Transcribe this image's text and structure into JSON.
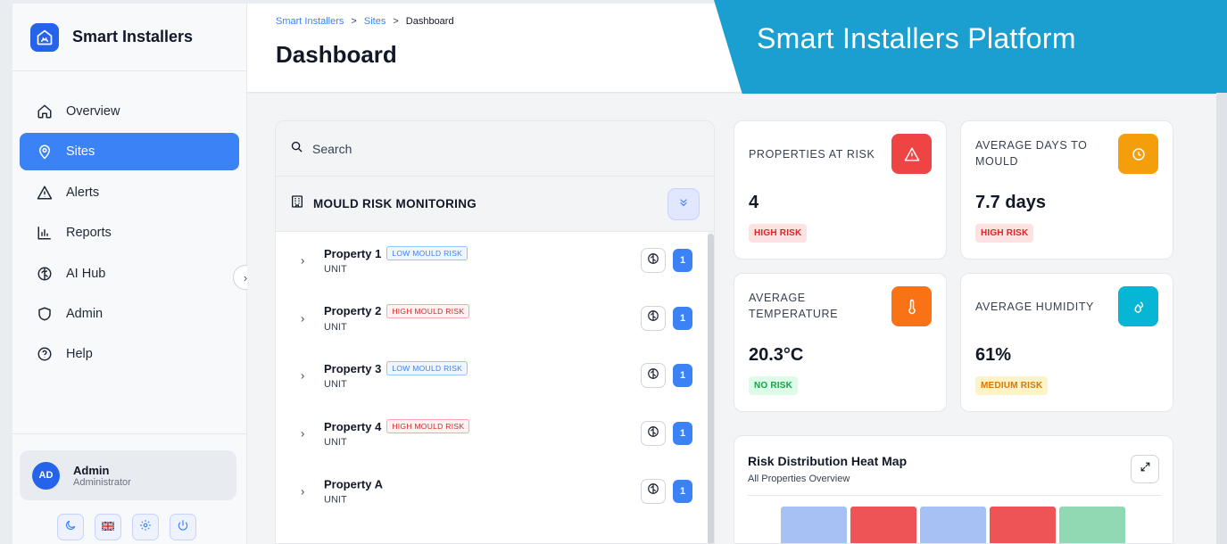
{
  "brand": {
    "name": "Smart Installers"
  },
  "sidebar": {
    "items": [
      {
        "label": "Overview",
        "icon": "home-icon"
      },
      {
        "label": "Sites",
        "icon": "location-pin-icon",
        "active": true
      },
      {
        "label": "Alerts",
        "icon": "warning-icon"
      },
      {
        "label": "Reports",
        "icon": "bar-chart-icon"
      },
      {
        "label": "AI Hub",
        "icon": "brain-icon"
      },
      {
        "label": "Admin",
        "icon": "shield-icon"
      },
      {
        "label": "Help",
        "icon": "help-circle-icon"
      }
    ]
  },
  "user": {
    "initials": "AD",
    "name": "Admin",
    "role": "Administrator"
  },
  "header": {
    "breadcrumb": [
      "Smart Installers",
      "Sites",
      "Dashboard"
    ],
    "title": "Dashboard"
  },
  "banner": {
    "text": "Smart Installers Platform"
  },
  "panel": {
    "search_placeholder": "Search",
    "section_title": "MOULD RISK MONITORING",
    "properties": [
      {
        "name": "Property 1",
        "badge": "LOW MOULD RISK",
        "level": "low",
        "sub": "UNIT",
        "count": "1"
      },
      {
        "name": "Property 2",
        "badge": "HIGH MOULD RISK",
        "level": "high",
        "sub": "UNIT",
        "count": "1"
      },
      {
        "name": "Property 3",
        "badge": "LOW MOULD RISK",
        "level": "low",
        "sub": "UNIT",
        "count": "1"
      },
      {
        "name": "Property 4",
        "badge": "HIGH MOULD RISK",
        "level": "high",
        "sub": "UNIT",
        "count": "1"
      },
      {
        "name": "Property A",
        "badge": "",
        "level": "",
        "sub": "UNIT",
        "count": "1"
      }
    ]
  },
  "stats": {
    "properties_at_risk": {
      "label": "PROPERTIES AT RISK",
      "value": "4",
      "badge": "HIGH RISK",
      "icon": "warning-icon",
      "color": "#ef4444"
    },
    "avg_days_to_mould": {
      "label": "AVERAGE DAYS TO MOULD",
      "value": "7.7 days",
      "badge": "HIGH RISK",
      "icon": "clock-icon",
      "color": "#f59e0b"
    },
    "avg_temperature": {
      "label": "AVERAGE TEMPERATURE",
      "value": "20.3°C",
      "badge": "NO RISK",
      "icon": "thermometer-icon",
      "color": "#f97316"
    },
    "avg_humidity": {
      "label": "AVERAGE HUMIDITY",
      "value": "61%",
      "badge": "MEDIUM RISK",
      "icon": "droplets-icon",
      "color": "#06b6d4"
    }
  },
  "heatmap": {
    "title": "Risk Distribution Heat Map",
    "subtitle": "All Properties Overview",
    "cells": [
      "#a8c1f4",
      "#ee5356",
      "#a8c1f4",
      "#ee5356",
      "#90d9b2"
    ]
  }
}
